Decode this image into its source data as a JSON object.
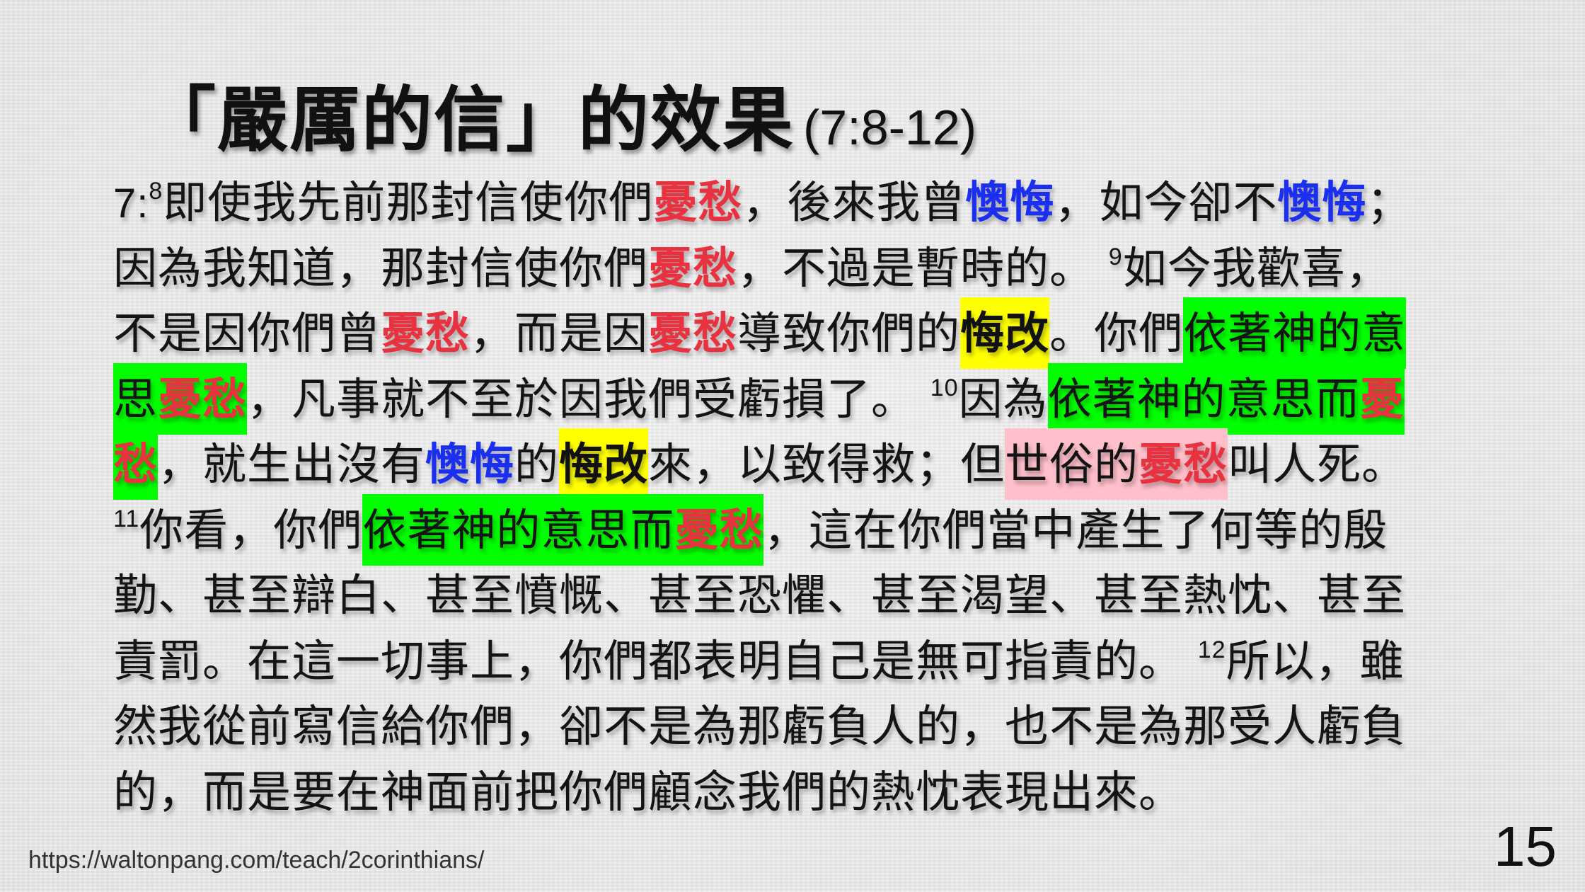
{
  "slide": {
    "title": "「嚴厲的信」的效果",
    "reference": "(7:8-12)",
    "source_url": "https://waltonpang.com/teach/2corinthians/",
    "page_number": "15"
  },
  "passage": {
    "l1": {
      "v_chapter": "7:",
      "v_num": "8",
      "a": "即使我先前那封信使你們",
      "b": "憂愁",
      "c": "，後來我曾",
      "d": "懊悔",
      "e": "，如今卻不",
      "f": "懊悔",
      "g": "；"
    },
    "l2": {
      "a": "因為我知道，那封信使你們",
      "b": "憂愁",
      "c": "，不過是暫時的。",
      "v_num": "9",
      "d": "如今我歡喜，"
    },
    "l3": {
      "a": "不是因你們曾",
      "b": "憂愁",
      "c": "，而是因",
      "d": "憂愁",
      "e": "導致你們的",
      "f": "悔改",
      "g": "。你們",
      "h": "依著神的意"
    },
    "l4": {
      "a": "思",
      "b": "憂愁",
      "c": "，凡事就不至於因我們受虧損了。",
      "v_num": "10",
      "d": "因為",
      "e": "依著神的意思而",
      "f": "憂"
    },
    "l5": {
      "a": "愁",
      "b": "，就生出沒有",
      "c": "懊悔",
      "d": "的",
      "e": "悔改",
      "f": "來，以致得救；但",
      "g": "世俗的",
      "h": "憂愁",
      "i": "叫人死。"
    },
    "l6": {
      "v_num": "11",
      "a": "你看，你們",
      "b": "依著神的意思而",
      "c": "憂愁",
      "d": "，這在你們當中產生了何等的殷"
    },
    "l7": "勤、甚至辯白、甚至憤慨、甚至恐懼、甚至渴望、甚至熱忱、甚至",
    "l8": {
      "a": "責罰。在這一切事上，你們都表明自己是無可指責的。",
      "v_num": "12",
      "b": "所以，雖"
    },
    "l9": "然我從前寫信給你們，卻不是為那虧負人的，也不是為那受人虧負",
    "l10": "的，而是要在神面前把你們顧念我們的熱忱表現出來。"
  },
  "colors": {
    "sorrow_red": "#e8323f",
    "regret_blue": "#1a2ff0",
    "repentance_highlight": "#ffff00",
    "godly_highlight": "#00ff00",
    "worldly_highlight": "#ffc0cb"
  }
}
